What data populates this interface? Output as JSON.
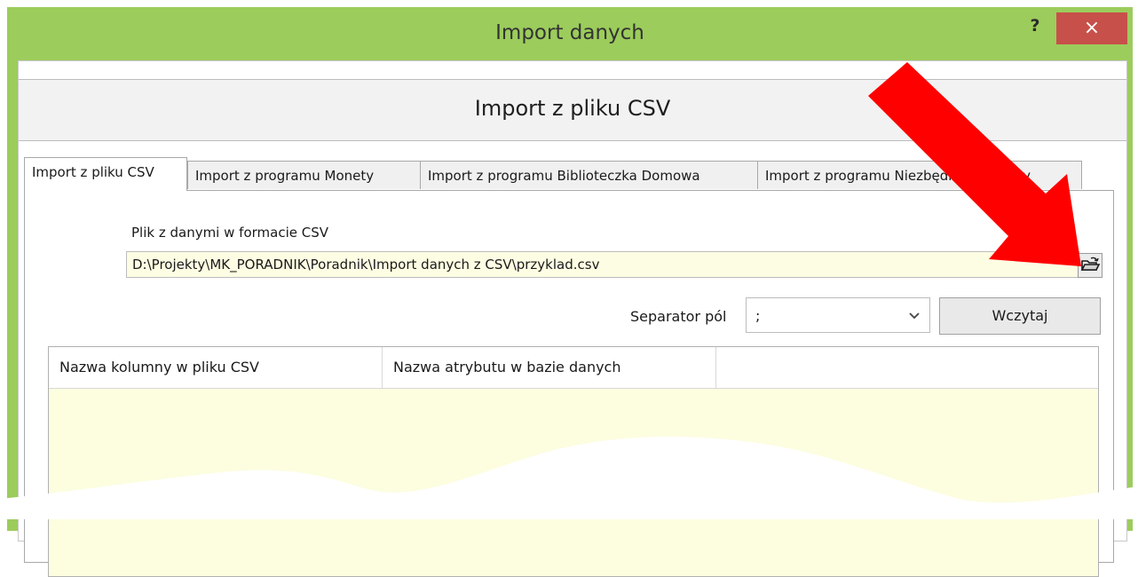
{
  "window": {
    "title": "Import danych",
    "help_label": "?",
    "close_label": "×"
  },
  "banner": {
    "title": "Import z pliku CSV"
  },
  "tabs": [
    {
      "label": "Import z pliku CSV",
      "active": true
    },
    {
      "label": "Import z programu Monety",
      "active": false
    },
    {
      "label": "Import z programu Biblioteczka Domowa",
      "active": false
    },
    {
      "label": "Import z programu Niezbędnik Domowy",
      "active": false
    }
  ],
  "file": {
    "label": "Plik z danymi w formacie CSV",
    "value": "D:\\Projekty\\MK_PORADNIK\\Poradnik\\Import danych z CSV\\przyklad.csv",
    "browse_icon": "folder-open-icon"
  },
  "separator": {
    "label": "Separator pól",
    "value": ";"
  },
  "load_button": "Wczytaj",
  "grid": {
    "columns": [
      "Nazwa kolumny w pliku CSV",
      "Nazwa atrybutu w bazie danych",
      ""
    ],
    "rows": []
  },
  "colors": {
    "titlebar": "#9ccc5c",
    "close": "#c7504a",
    "input_bg": "#fdfde3",
    "arrow": "#ff0000"
  }
}
